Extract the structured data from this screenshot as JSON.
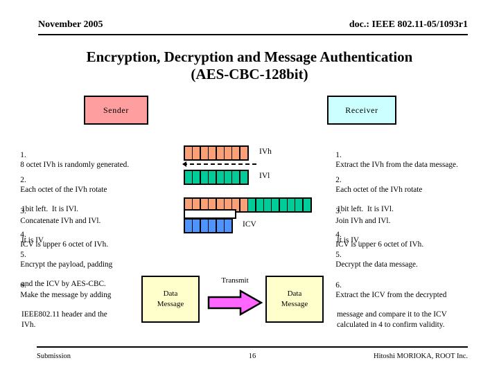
{
  "header": {
    "date": "November 2005",
    "doc_id": "doc.: IEEE 802.11-05/1093r1"
  },
  "title": {
    "line1": "Encryption, Decryption and Message Authentication",
    "line2": "(AES-CBC-128bit)"
  },
  "roles": {
    "sender": "Sender",
    "receiver": "Receiver",
    "sender_color": "#ff9e9e",
    "receiver_color": "#ccffff"
  },
  "sender_steps": [
    {
      "num": "1.",
      "text": "8 octet IVh is randomly generated.",
      "cont": ""
    },
    {
      "num": "2.",
      "text": "Each octet of the IVh rotate",
      "cont": "1bit left.  It is IVl."
    },
    {
      "num": "3.",
      "text": "Concatenate IVh and IVl.",
      "cont": "It is IV."
    },
    {
      "num": "4.",
      "text": "ICV is upper 6 octet of IVh.",
      "cont": ""
    },
    {
      "num": "5.",
      "text": "Encrypt the payload, padding",
      "cont": "and the ICV by AES-CBC."
    },
    {
      "num": "6.",
      "text": "Make the message by adding",
      "cont": "IEEE802.11 header and the\nIVh."
    }
  ],
  "receiver_steps": [
    {
      "num": "1.",
      "text": "Extract the IVh from the data message.",
      "cont": ""
    },
    {
      "num": "2.",
      "text": "Each octet of the IVh rotate",
      "cont": "1bit left.  It is IVl."
    },
    {
      "num": "3.",
      "text": "Join IVh and IVl.",
      "cont": "It is IV."
    },
    {
      "num": "4.",
      "text": "ICV is upper 6 octet of IVh.",
      "cont": ""
    },
    {
      "num": "5.",
      "text": "Decrypt the data message.",
      "cont": ""
    },
    {
      "num": "6.",
      "text": "Extract the ICV from the decrypted",
      "cont": "message and compare it to the ICV\ncalculated in 4 to confirm validity."
    }
  ],
  "diagram": {
    "ivh_label": "IVh",
    "ivl_label": "IVl",
    "icv_label": "ICV",
    "ivh_octets": 8,
    "ivl_octets": 8,
    "iv_orange_octets": 8,
    "iv_green_octets": 8,
    "icv_octets": 6,
    "colors": {
      "ivh_orange": "#f9a077",
      "ivl_green": "#00cc99",
      "icv_blue": "#4d94ff",
      "message_yellow": "#ffffcc",
      "transmit_magenta": "#ff66ff"
    }
  },
  "transmit": {
    "label": "Transmit",
    "left_box_line1": "Data",
    "left_box_line2": "Message",
    "right_box_line1": "Data",
    "right_box_line2": "Message"
  },
  "footer": {
    "left": "Submission",
    "page": "16",
    "right": "Hitoshi MORIOKA, ROOT Inc."
  }
}
